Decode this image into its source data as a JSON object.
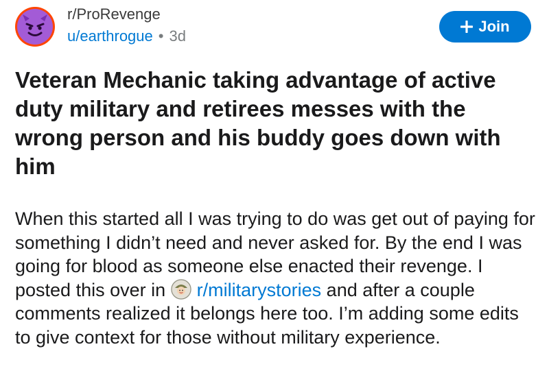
{
  "header": {
    "subreddit": "r/ProRevenge",
    "username": "u/earthrogue",
    "separator": "•",
    "age": "3d",
    "join_label": "Join",
    "join_icon": "plus-icon"
  },
  "post": {
    "title": "Veteran Mechanic taking advantage of active duty military and retirees messes with the wrong person and his buddy goes down with him",
    "body_part1": "When this started all I was trying to do was get out of paying for something I didn’t need and never asked for. By the end I was going for blood as someone else enacted their revenge. I posted this over in",
    "linked_subreddit": "r/militarystories",
    "body_part2": "and after a couple comments realized it belongs here too. I’m adding some edits to give context for those without military experience."
  },
  "colors": {
    "accent": "#0079d3",
    "avatar_ring": "#ff4500",
    "avatar_fill": "#a35bd6"
  }
}
